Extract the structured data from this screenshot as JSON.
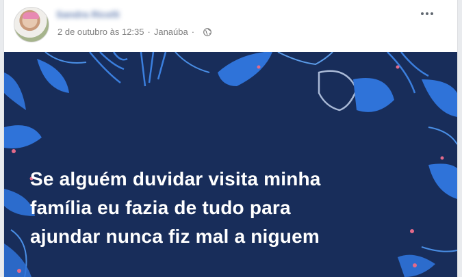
{
  "post": {
    "author_name": "Sandra Ricelli",
    "date": "2 de outubro às 12:35",
    "separator": "·",
    "location": "Janaúba",
    "privacy_icon": "globe-icon",
    "more_icon": "more-options-icon"
  },
  "image": {
    "lines": [
      "Se alguém duvidar visita minha",
      "família eu fazia de tudo para",
      "ajundar nunca fiz mal a niguem"
    ]
  },
  "colors": {
    "image_background": "#182d5a",
    "leaf_blue": "#2f73d9",
    "text": "#ffffff"
  }
}
